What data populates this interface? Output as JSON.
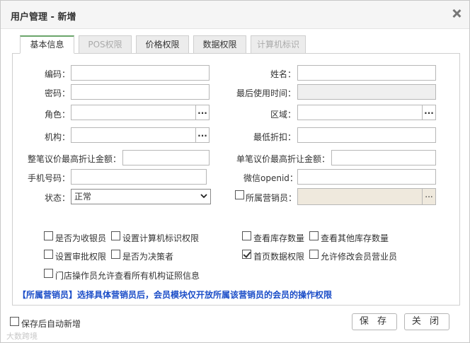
{
  "dialog": {
    "title": "用户管理 - 新增",
    "close_glyph": "×"
  },
  "tabs": [
    {
      "label": "基本信息",
      "state": "active"
    },
    {
      "label": "POS权限",
      "state": "disabled"
    },
    {
      "label": "价格权限",
      "state": "normal"
    },
    {
      "label": "数据权限",
      "state": "normal"
    },
    {
      "label": "计算机标识",
      "state": "disabled"
    }
  ],
  "form": {
    "code_label": "编码：",
    "code_value": "",
    "name_label": "姓名：",
    "name_value": "",
    "password_label": "密码：",
    "password_value": "",
    "last_used_label": "最后使用时间：",
    "last_used_value": "",
    "role_label": "角色：",
    "role_value": "",
    "region_label": "区域：",
    "region_value": "",
    "org_label": "机构：",
    "org_value": "",
    "min_discount_label": "最低折扣：",
    "min_discount_value": "",
    "whole_bargain_label": "整笔议价最高折让金额：",
    "whole_bargain_value": "",
    "single_bargain_label": "单笔议价最高折让金额：",
    "single_bargain_value": "",
    "phone_label": "手机号码：",
    "phone_value": "",
    "wechat_label": "微信openid：",
    "wechat_value": "",
    "status_label": "状态：",
    "status_value": "正常",
    "salesperson_label": "所属营销员：",
    "salesperson_value": "",
    "ellipsis": "..."
  },
  "checkboxes": [
    {
      "label": "是否为收银员",
      "checked": false
    },
    {
      "label": "设置计算机标识权限",
      "checked": false
    },
    {
      "label": "查看库存数量",
      "checked": false
    },
    {
      "label": "查看其他库存数量",
      "checked": false
    },
    {
      "label": "设置审批权限",
      "checked": false
    },
    {
      "label": "是否为决策者",
      "checked": false
    },
    {
      "label": "首页数据权限",
      "checked": true
    },
    {
      "label": "允许修改会员营业员",
      "checked": false
    },
    {
      "label": "门店操作员允许查看所有机构证照信息",
      "checked": false
    }
  ],
  "note": "【所属营销员】选择具体营销员后，会员模块仅开放所属该营销员的会员的操作权限",
  "footer": {
    "auto_new_label": "保存后自动新增",
    "auto_new_checked": false,
    "save_label": "保 存",
    "close_label": "关 闭"
  },
  "watermark": "大数跨境"
}
